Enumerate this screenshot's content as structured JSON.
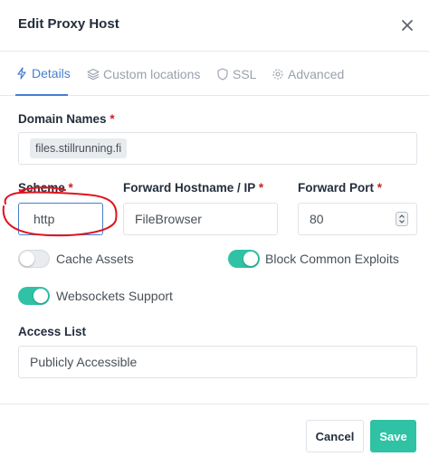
{
  "modal": {
    "title": "Edit Proxy Host"
  },
  "tabs": [
    {
      "label": "Details",
      "icon": "bolt-icon",
      "active": true
    },
    {
      "label": "Custom locations",
      "icon": "layers-icon",
      "active": false
    },
    {
      "label": "SSL",
      "icon": "shield-icon",
      "active": false
    },
    {
      "label": "Advanced",
      "icon": "gear-icon",
      "active": false
    }
  ],
  "form": {
    "domain_names": {
      "label": "Domain Names",
      "required_mark": "*",
      "chips": [
        "files.stillrunning.fi"
      ]
    },
    "scheme": {
      "label": "Scheme",
      "required_mark": "*",
      "value": "http"
    },
    "forward_hostname": {
      "label": "Forward Hostname / IP",
      "required_mark": "*",
      "value": "FileBrowser"
    },
    "forward_port": {
      "label": "Forward Port",
      "required_mark": "*",
      "value": "80"
    },
    "cache_assets": {
      "label": "Cache Assets",
      "enabled": false
    },
    "block_exploits": {
      "label": "Block Common Exploits",
      "enabled": true
    },
    "websockets": {
      "label": "Websockets Support",
      "enabled": true
    },
    "access_list": {
      "label": "Access List",
      "value": "Publicly Accessible"
    }
  },
  "footer": {
    "cancel_label": "Cancel",
    "save_label": "Save"
  },
  "colors": {
    "accent": "#467fcf",
    "toggle_on": "#2fc2a4",
    "required": "#cd201f",
    "annotation": "#e0141e"
  }
}
